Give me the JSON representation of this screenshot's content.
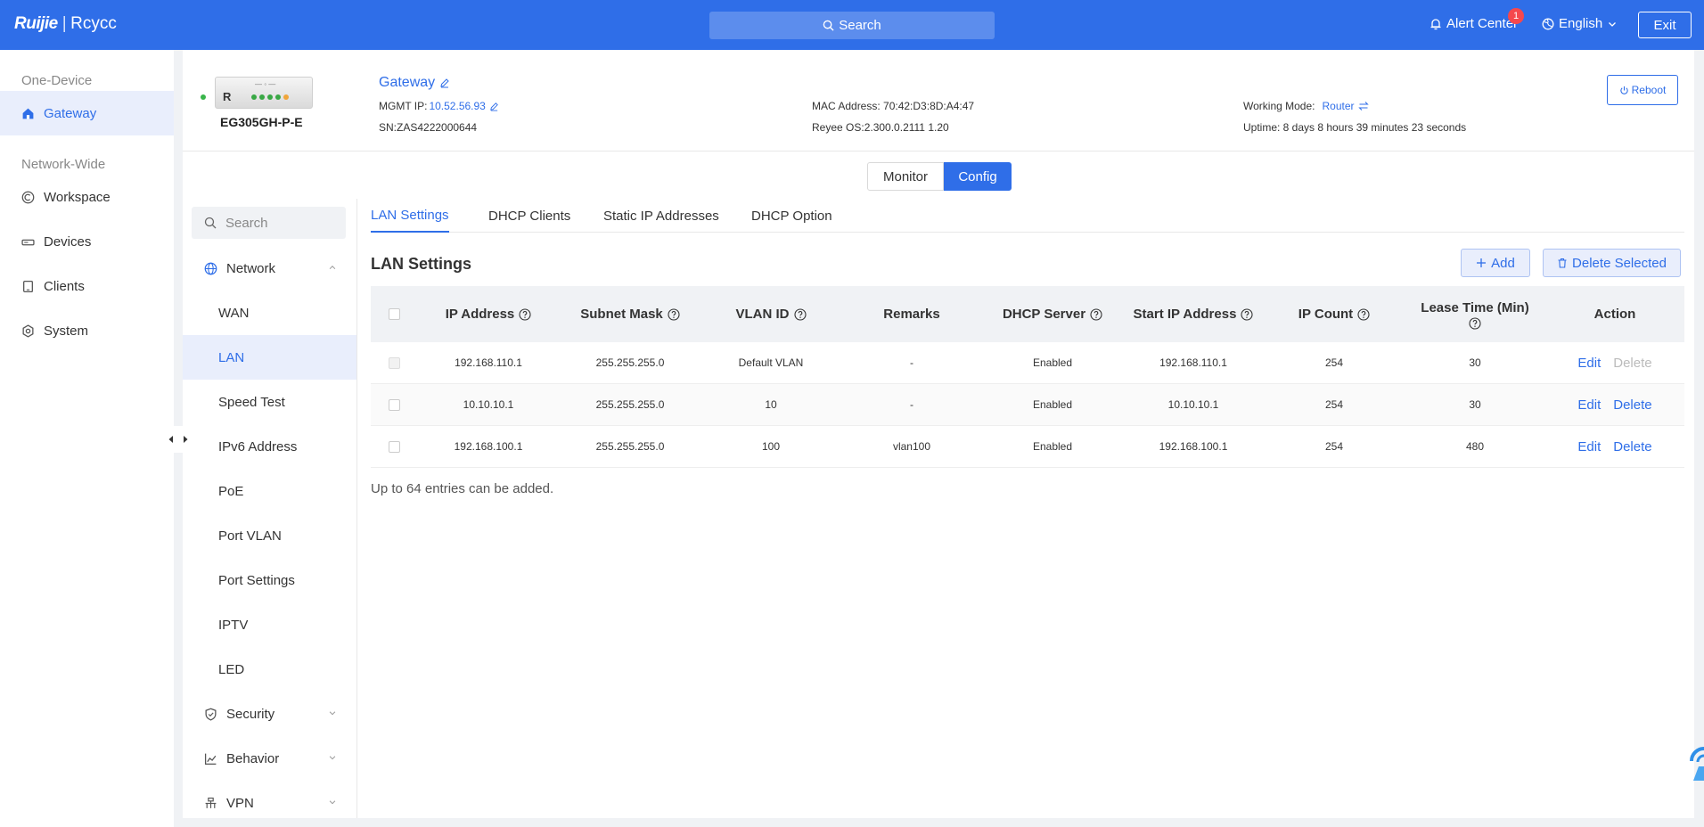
{
  "topbar": {
    "brand": "Ruijie",
    "brand_sep": "|",
    "brand_sub": "Rcycc",
    "search_label": "Search",
    "alert_label": "Alert Center",
    "alert_count": "1",
    "language": "English",
    "exit_label": "Exit"
  },
  "sidebar": {
    "group1": "One-Device",
    "gateway": "Gateway",
    "group2": "Network-Wide",
    "workspace": "Workspace",
    "devices": "Devices",
    "clients": "Clients",
    "system": "System"
  },
  "device": {
    "name": "Gateway",
    "model": "EG305GH-P-E",
    "mgmt_label": "MGMT IP:",
    "mgmt_ip": "10.52.56.93",
    "sn": "SN:ZAS4222000644",
    "mac": "MAC Address: 70:42:D3:8D:A4:47",
    "os": "Reyee OS:2.300.0.2111 1.20",
    "mode_label": "Working Mode:",
    "mode_value": "Router",
    "uptime": "Uptime: 8 days 8 hours 39 minutes 23 seconds",
    "reboot_label": "Reboot",
    "image_letter": "R"
  },
  "mode_switch": {
    "monitor": "Monitor",
    "config": "Config"
  },
  "subnav": {
    "search_placeholder": "Search",
    "network": "Network",
    "items": [
      "WAN",
      "LAN",
      "Speed Test",
      "IPv6 Address",
      "PoE",
      "Port VLAN",
      "Port Settings",
      "IPTV",
      "LED"
    ],
    "security": "Security",
    "behavior": "Behavior",
    "vpn": "VPN"
  },
  "tabs": [
    "LAN Settings",
    "DHCP Clients",
    "Static IP Addresses",
    "DHCP Option"
  ],
  "section": {
    "title": "LAN Settings",
    "add_label": "Add",
    "delete_selected_label": "Delete Selected",
    "note": "Up to 64 entries can be added."
  },
  "table": {
    "headers": {
      "ip": "IP Address",
      "mask": "Subnet Mask",
      "vlan": "VLAN ID",
      "remarks": "Remarks",
      "dhcp": "DHCP Server",
      "start": "Start IP Address",
      "count": "IP Count",
      "lease": "Lease Time (Min)",
      "action": "Action"
    },
    "edit_label": "Edit",
    "delete_label": "Delete",
    "rows": [
      {
        "ip": "192.168.110.1",
        "mask": "255.255.255.0",
        "vlan": "Default VLAN",
        "remarks": "-",
        "dhcp": "Enabled",
        "start": "192.168.110.1",
        "count": "254",
        "lease": "30"
      },
      {
        "ip": "10.10.10.1",
        "mask": "255.255.255.0",
        "vlan": "10",
        "remarks": "-",
        "dhcp": "Enabled",
        "start": "10.10.10.1",
        "count": "254",
        "lease": "30"
      },
      {
        "ip": "192.168.100.1",
        "mask": "255.255.255.0",
        "vlan": "100",
        "remarks": "vlan100",
        "dhcp": "Enabled",
        "start": "192.168.100.1",
        "count": "254",
        "lease": "480"
      }
    ]
  },
  "colors": {
    "primary": "#2f6ee8",
    "badge": "#f5484d",
    "online": "#39b54a"
  }
}
